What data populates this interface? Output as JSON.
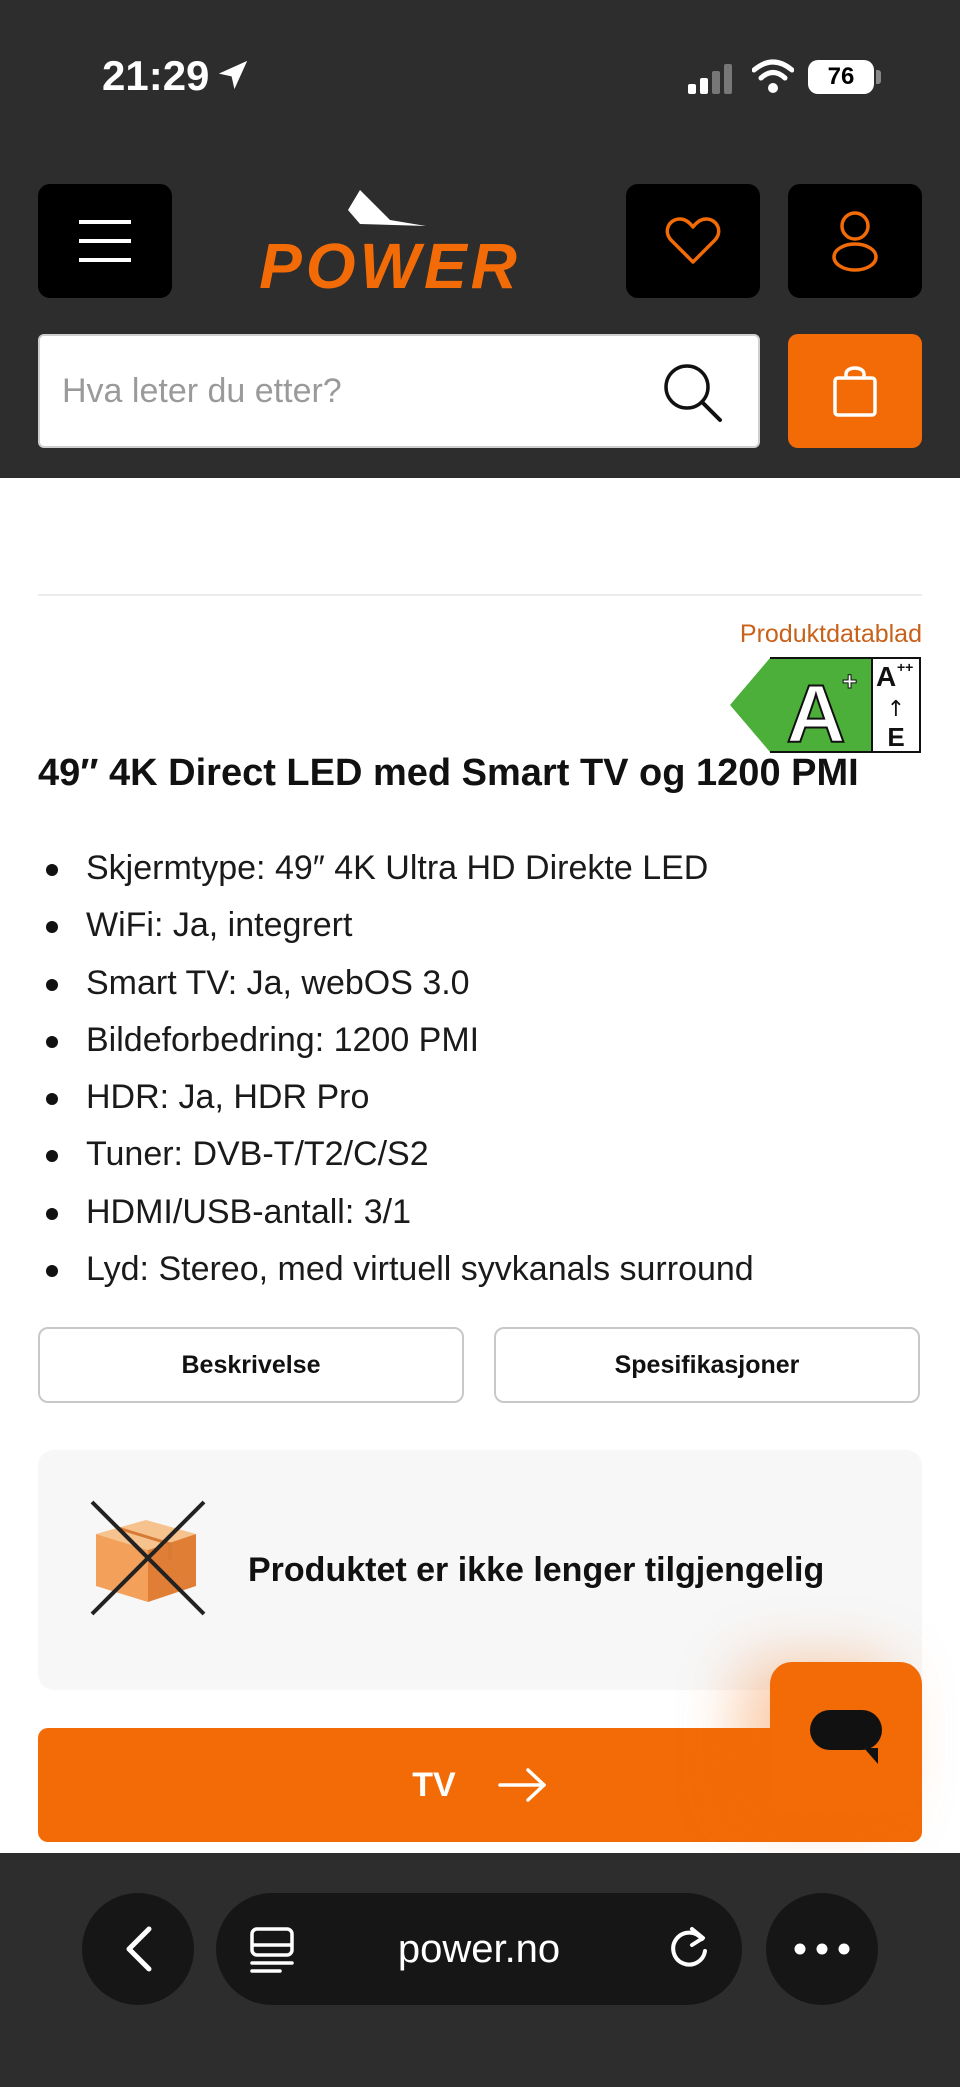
{
  "status_bar": {
    "time": "21:29",
    "battery": "76",
    "icons": [
      "location-arrow-icon",
      "signal-icon",
      "wifi-icon",
      "battery-icon"
    ]
  },
  "header": {
    "brand": "POWER",
    "search": {
      "placeholder": "Hva leter du etter?",
      "value": ""
    },
    "icons": [
      "menu-icon",
      "heart-icon",
      "user-icon",
      "search-icon",
      "shopping-bag-icon"
    ]
  },
  "colors": {
    "brand_orange": "#f26b07",
    "header_bg": "#2d2d2d",
    "energy_green": "#4caf3a",
    "datablad_link": "#c8611a"
  },
  "product": {
    "datablad_link": "Produktdatablad",
    "energy_label": {
      "class": "A",
      "class_sup": "+",
      "scale_top": "A",
      "scale_top_sup": "++",
      "scale_arrow": "↑",
      "scale_bottom": "E"
    },
    "title": "49″ 4K Direct LED med Smart TV og 1200 PMI",
    "specs": [
      "Skjermtype: 49″ 4K Ultra HD Direkte LED",
      "WiFi: Ja, integrert",
      "Smart TV: Ja, webOS 3.0",
      "Bildeforbedring: 1200 PMI",
      "HDR: Ja, HDR Pro",
      "Tuner: DVB-T/T2/C/S2",
      "HDMI/USB-antall: 3/1",
      "Lyd: Stereo, med virtuell syvkanals surround"
    ],
    "tabs": [
      "Beskrivelse",
      "Spesifikasjoner"
    ],
    "unavailable_text": "Produktet er ikke lenger tilgjengelig",
    "category_button": "TV"
  },
  "browser": {
    "url": "power.no",
    "icons": [
      "back-icon",
      "reader-icon",
      "reload-icon",
      "more-icon"
    ]
  }
}
